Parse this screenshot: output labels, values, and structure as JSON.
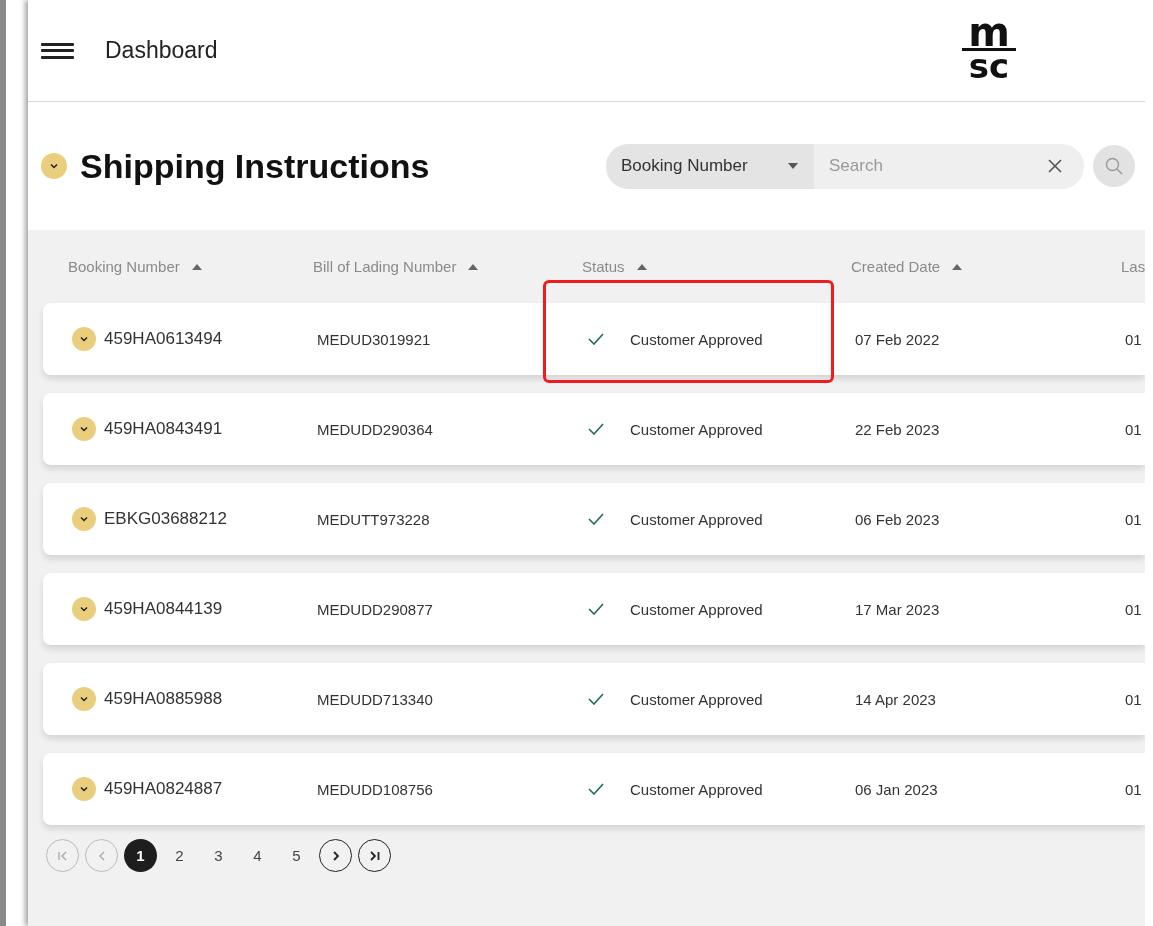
{
  "header": {
    "title": "Dashboard",
    "logo": {
      "top": "m",
      "bottom": "sc"
    }
  },
  "page": {
    "title": "Shipping Instructions"
  },
  "search": {
    "filter": "Booking Number",
    "placeholder": "Search"
  },
  "table": {
    "columns": [
      {
        "label": "Booking Number",
        "sortable": true
      },
      {
        "label": "Bill of Lading Number",
        "sortable": true
      },
      {
        "label": "Status",
        "sortable": true
      },
      {
        "label": "Created Date",
        "sortable": true
      },
      {
        "label": "Las",
        "sortable": false
      }
    ],
    "rows": [
      {
        "booking": "459HA0613494",
        "bol": "MEDUD3019921",
        "status": "Customer Approved",
        "approved": true,
        "created": "07 Feb 2022",
        "column_5": "01",
        "highlighted": true
      },
      {
        "booking": "459HA0843491",
        "bol": "MEDUDD290364",
        "status": "Customer Approved",
        "approved": true,
        "created": "22 Feb 2023",
        "column_5": "01",
        "highlighted": false
      },
      {
        "booking": "EBKG03688212",
        "bol": "MEDUTT973228",
        "status": "Customer Approved",
        "approved": true,
        "created": "06 Feb 2023",
        "column_5": "01",
        "highlighted": false
      },
      {
        "booking": "459HA0844139",
        "bol": "MEDUDD290877",
        "status": "Customer Approved",
        "approved": true,
        "created": "17 Mar 2023",
        "column_5": "01",
        "highlighted": false
      },
      {
        "booking": "459HA0885988",
        "bol": "MEDUDD713340",
        "status": "Customer Approved",
        "approved": true,
        "created": "14 Apr 2023",
        "column_5": "01",
        "highlighted": false
      },
      {
        "booking": "459HA0824887",
        "bol": "MEDUDD108756",
        "status": "Customer Approved",
        "approved": true,
        "created": "06 Jan 2023",
        "column_5": "01",
        "highlighted": false
      }
    ]
  },
  "pagination": {
    "first_disabled": true,
    "prev_disabled": true,
    "next_disabled": false,
    "last_disabled": false,
    "pages": [
      {
        "label": "1",
        "selected": true
      },
      {
        "label": "2",
        "selected": false
      },
      {
        "label": "3",
        "selected": false
      },
      {
        "label": "4",
        "selected": false
      },
      {
        "label": "5",
        "selected": false
      }
    ]
  }
}
